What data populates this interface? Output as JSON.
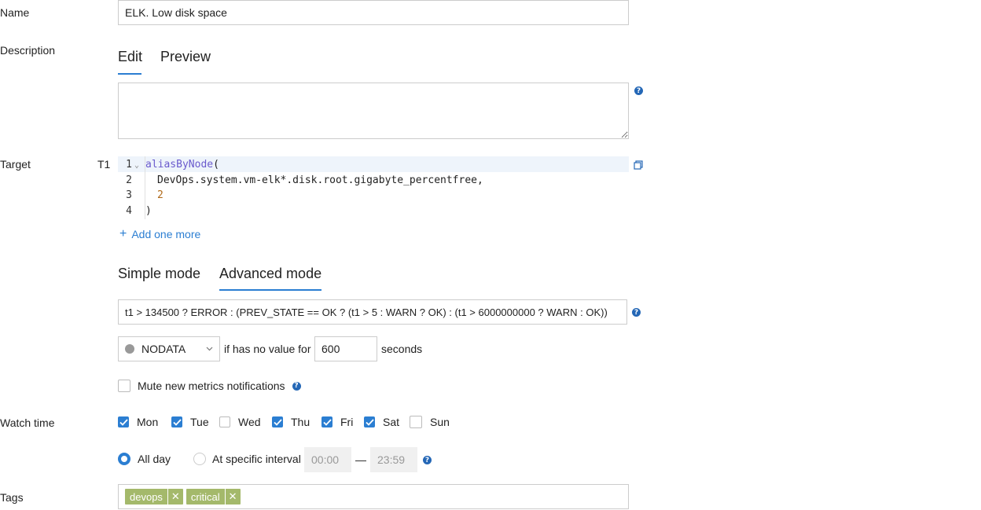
{
  "labels": {
    "name": "Name",
    "description": "Description",
    "target": "Target",
    "watch_time": "Watch time",
    "tags": "Tags"
  },
  "name_value": "ELK. Low disk space",
  "description": {
    "tabs": [
      "Edit",
      "Preview"
    ],
    "active_tab": "Edit",
    "value": ""
  },
  "target": {
    "id": "T1",
    "lines": [
      {
        "num": "1",
        "text": "aliasByNode("
      },
      {
        "num": "2",
        "text": "DevOps.system.vm-elk*.disk.root.gigabyte_percentfree,"
      },
      {
        "num": "3",
        "text": "2"
      },
      {
        "num": "4",
        "text": ")"
      }
    ],
    "add_more": "Add one more"
  },
  "mode_tabs": [
    "Simple mode",
    "Advanced mode"
  ],
  "active_mode": "Advanced mode",
  "expression": "t1 > 134500 ? ERROR : (PREV_STATE == OK ? (t1 > 5 : WARN ? OK) : (t1 > 6000000000 ? WARN : OK))",
  "nodata": {
    "state": "NODATA",
    "text_before": "if has no value for",
    "seconds_value": "600",
    "text_after": "seconds"
  },
  "mute": {
    "label": "Mute new metrics notifications",
    "checked": false
  },
  "days": [
    {
      "label": "Mon",
      "checked": true
    },
    {
      "label": "Tue",
      "checked": true
    },
    {
      "label": "Wed",
      "checked": false
    },
    {
      "label": "Thu",
      "checked": true
    },
    {
      "label": "Fri",
      "checked": true
    },
    {
      "label": "Sat",
      "checked": true
    },
    {
      "label": "Sun",
      "checked": false
    }
  ],
  "watch": {
    "all_day": "All day",
    "specific": "At specific interval",
    "from": "00:00",
    "dash": "—",
    "to": "23:59",
    "selected": "all_day"
  },
  "tags": [
    "devops",
    "critical"
  ],
  "colors": {
    "accent": "#2b7ed2",
    "tag": "#a4b96b",
    "keyword": "#6a5acd",
    "number": "#b06a1a"
  }
}
